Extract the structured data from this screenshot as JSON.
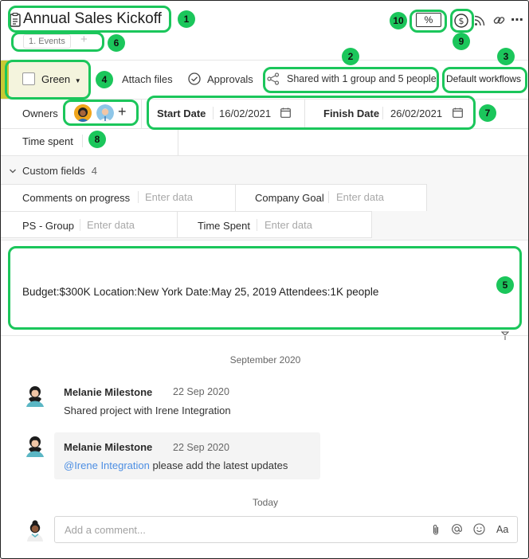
{
  "header": {
    "title": "Annual Sales Kickoff",
    "breadcrumb_tab": "1. Events",
    "add_tab": "+",
    "percent_label": "%",
    "more_label": "⋯"
  },
  "toolbar": {
    "status_label": "Green",
    "attach_label": "Attach files",
    "approvals_label": "Approvals",
    "shared_label": "Shared with 1 group and 5 people",
    "workflow_label": "Default workflows"
  },
  "fields": {
    "owners_label": "Owners",
    "add_owner": "+",
    "start_label": "Start Date",
    "start_value": "16/02/2021",
    "finish_label": "Finish Date",
    "finish_value": "26/02/2021",
    "time_spent_label": "Time spent"
  },
  "custom_fields": {
    "header": "Custom fields",
    "count": "4",
    "items": [
      {
        "label": "Comments on progress",
        "placeholder": "Enter data"
      },
      {
        "label": "Company Goal",
        "placeholder": "Enter data"
      },
      {
        "label": "PS - Group",
        "placeholder": "Enter data"
      },
      {
        "label": "Time Spent",
        "placeholder": "Enter data"
      }
    ]
  },
  "description": "Budget:$300K Location:New York Date:May 25, 2019 Attendees:1K people",
  "activity": {
    "month_header": "September 2020",
    "entries": [
      {
        "author": "Melanie Milestone",
        "date": "22 Sep 2020",
        "text": "Shared project with Irene Integration"
      },
      {
        "author": "Melanie Milestone",
        "date": "22 Sep 2020",
        "mention": "@Irene Integration",
        "text": " please add the latest updates"
      }
    ],
    "today_header": "Today"
  },
  "comment": {
    "placeholder": "Add a comment...",
    "format_label": "Aa"
  },
  "callouts": [
    "1",
    "2",
    "3",
    "4",
    "5",
    "6",
    "7",
    "8",
    "9",
    "10"
  ],
  "colors": {
    "callout": "#1bc65b",
    "status_bar": "#c9c934",
    "status_bg": "#f4f4dd",
    "mention": "#4c8ee3"
  }
}
